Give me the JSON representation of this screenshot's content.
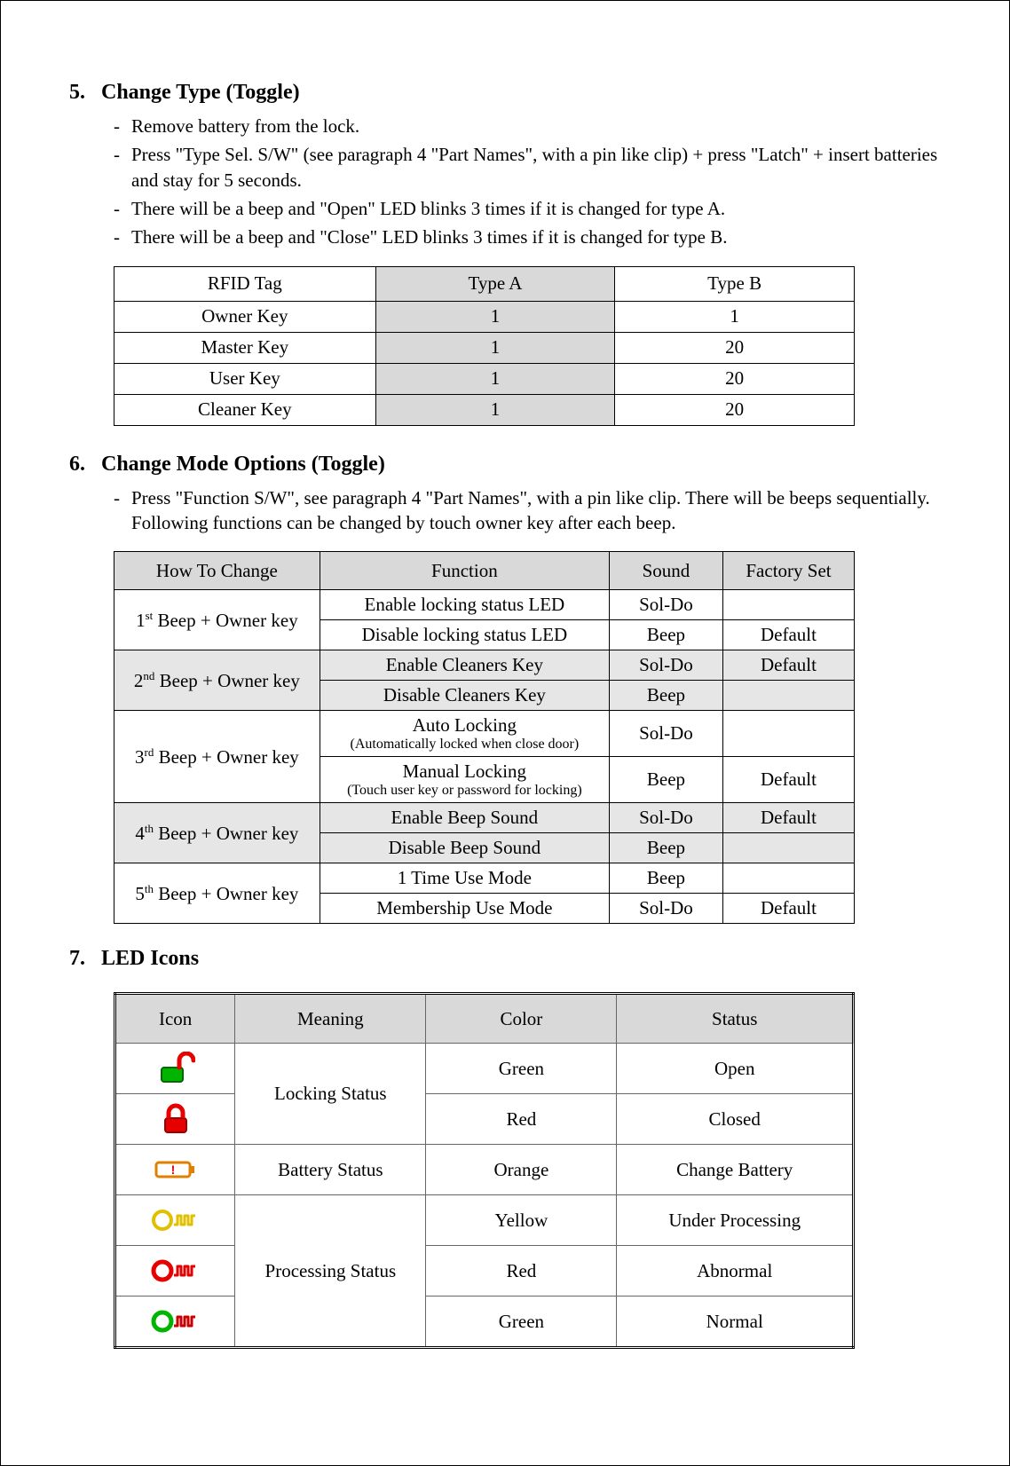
{
  "sections": {
    "s5": {
      "num": "5.",
      "title": "Change Type (Toggle)",
      "bullets": [
        "Remove battery from the lock.",
        "Press \"Type Sel. S/W\" (see paragraph 4 \"Part Names\", with a pin like clip) + press \"Latch\" + insert batteries and stay for 5 seconds.",
        "There will be a beep and \"Open\" LED blinks 3 times if it is changed for type A.",
        "There will be a beep and \"Close\" LED blinks 3 times if it is changed for type B."
      ]
    },
    "s6": {
      "num": "6.",
      "title": "Change Mode Options (Toggle)",
      "bullets": [
        "Press \"Function S/W\", see paragraph 4 \"Part Names\", with a pin like clip. There will be beeps sequentially. Following functions can be changed by touch owner key after each beep."
      ]
    },
    "s7": {
      "num": "7.",
      "title": "LED Icons"
    }
  },
  "table_rfid": {
    "headers": [
      "RFID Tag",
      "Type A",
      "Type B"
    ],
    "rows": [
      [
        "Owner Key",
        "1",
        "1"
      ],
      [
        "Master Key",
        "1",
        "20"
      ],
      [
        "User Key",
        "1",
        "20"
      ],
      [
        "Cleaner Key",
        "1",
        "20"
      ]
    ]
  },
  "table_mode": {
    "headers": [
      "How To Change",
      "Function",
      "Sound",
      "Factory Set"
    ],
    "groups": [
      {
        "beep_pre": "1",
        "beep_suf": "st",
        "beep_rest": " Beep + Owner key",
        "rows": [
          {
            "func": "Enable locking status LED",
            "sub": "",
            "sound": "Sol-Do",
            "factory": "",
            "shade": false
          },
          {
            "func": "Disable locking status LED",
            "sub": "",
            "sound": "Beep",
            "factory": "Default",
            "shade": false
          }
        ]
      },
      {
        "beep_pre": "2",
        "beep_suf": "nd",
        "beep_rest": " Beep + Owner key",
        "rows": [
          {
            "func": "Enable Cleaners Key",
            "sub": "",
            "sound": "Sol-Do",
            "factory": "Default",
            "shade": true
          },
          {
            "func": "Disable Cleaners Key",
            "sub": "",
            "sound": "Beep",
            "factory": "",
            "shade": true
          }
        ]
      },
      {
        "beep_pre": "3",
        "beep_suf": "rd",
        "beep_rest": " Beep + Owner key",
        "rows": [
          {
            "func": "Auto Locking",
            "sub": "(Automatically locked when close door)",
            "sound": "Sol-Do",
            "factory": "",
            "shade": false
          },
          {
            "func": "Manual Locking",
            "sub": "(Touch user key or password for locking)",
            "sound": "Beep",
            "factory": "Default",
            "shade": false
          }
        ]
      },
      {
        "beep_pre": "4",
        "beep_suf": "th",
        "beep_rest": " Beep + Owner key",
        "rows": [
          {
            "func": "Enable Beep Sound",
            "sub": "",
            "sound": "Sol-Do",
            "factory": "Default",
            "shade": true
          },
          {
            "func": "Disable Beep Sound",
            "sub": "",
            "sound": "Beep",
            "factory": "",
            "shade": true
          }
        ]
      },
      {
        "beep_pre": "5",
        "beep_suf": "th",
        "beep_rest": " Beep + Owner key",
        "rows": [
          {
            "func": "1 Time Use Mode",
            "sub": "",
            "sound": "Beep",
            "factory": "",
            "shade": false
          },
          {
            "func": "Membership Use Mode",
            "sub": "",
            "sound": "Sol-Do",
            "factory": "Default",
            "shade": false
          }
        ]
      }
    ]
  },
  "table_led": {
    "headers": [
      "Icon",
      "Meaning",
      "Color",
      "Status"
    ],
    "groups": [
      {
        "meaning": "Locking Status",
        "rows": [
          {
            "icon": "lock-open-green",
            "color": "Green",
            "status": "Open"
          },
          {
            "icon": "lock-closed-red",
            "color": "Red",
            "status": "Closed"
          }
        ]
      },
      {
        "meaning": "Battery Status",
        "rows": [
          {
            "icon": "battery-orange",
            "color": "Orange",
            "status": "Change Battery"
          }
        ]
      },
      {
        "meaning": "Processing Status",
        "rows": [
          {
            "icon": "process-yellow",
            "color": "Yellow",
            "status": "Under Processing"
          },
          {
            "icon": "process-red",
            "color": "Red",
            "status": "Abnormal"
          },
          {
            "icon": "process-green",
            "color": "Green",
            "status": "Normal"
          }
        ]
      }
    ]
  }
}
